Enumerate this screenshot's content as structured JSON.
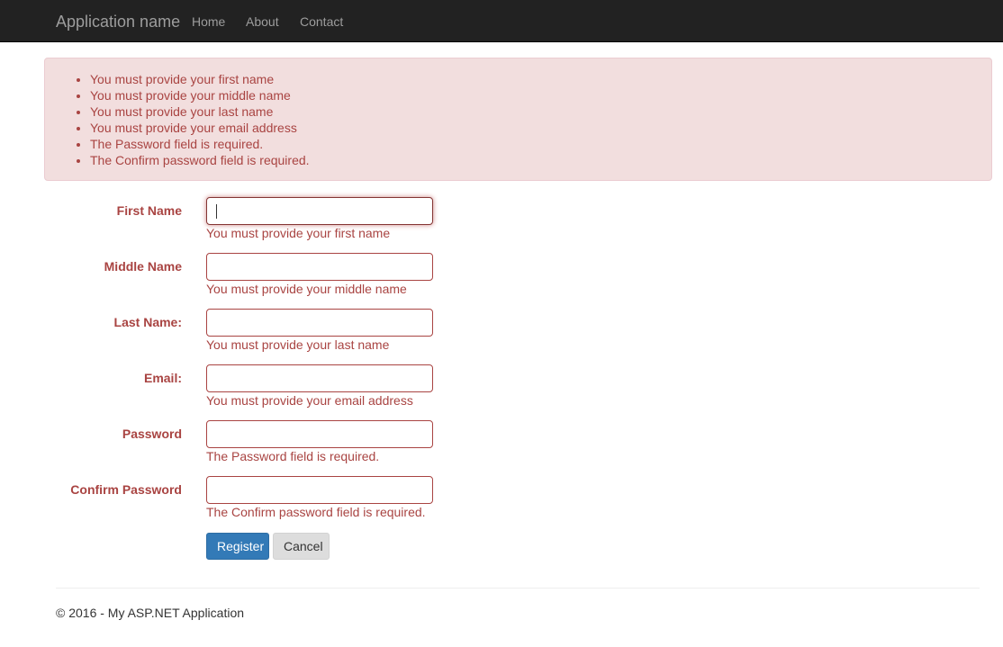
{
  "navbar": {
    "brand": "Application name",
    "links": [
      "Home",
      "About",
      "Contact"
    ]
  },
  "summary": {
    "errors": [
      "You must provide your first name",
      "You must provide your middle name",
      "You must provide your last name",
      "You must provide your email address",
      "The Password field is required.",
      "The Confirm password field is required."
    ]
  },
  "form": {
    "fields": [
      {
        "label": "First Name",
        "value": "",
        "error": "You must provide your first name"
      },
      {
        "label": "Middle Name",
        "value": "",
        "error": "You must provide your middle name"
      },
      {
        "label": "Last Name:",
        "value": "",
        "error": "You must provide your last name"
      },
      {
        "label": "Email:",
        "value": "",
        "error": "You must provide your email address"
      },
      {
        "label": "Password",
        "value": "",
        "error": "The Password field is required."
      },
      {
        "label": "Confirm Password",
        "value": "",
        "error": "The Confirm password field is required."
      }
    ],
    "register_label": "Register",
    "cancel_label": "Cancel"
  },
  "footer": {
    "text": "© 2016 - My ASP.NET Application"
  },
  "colors": {
    "navbar_bg": "#222222",
    "error_text": "#a94442",
    "alert_bg": "#f2dede",
    "primary": "#337ab7"
  }
}
